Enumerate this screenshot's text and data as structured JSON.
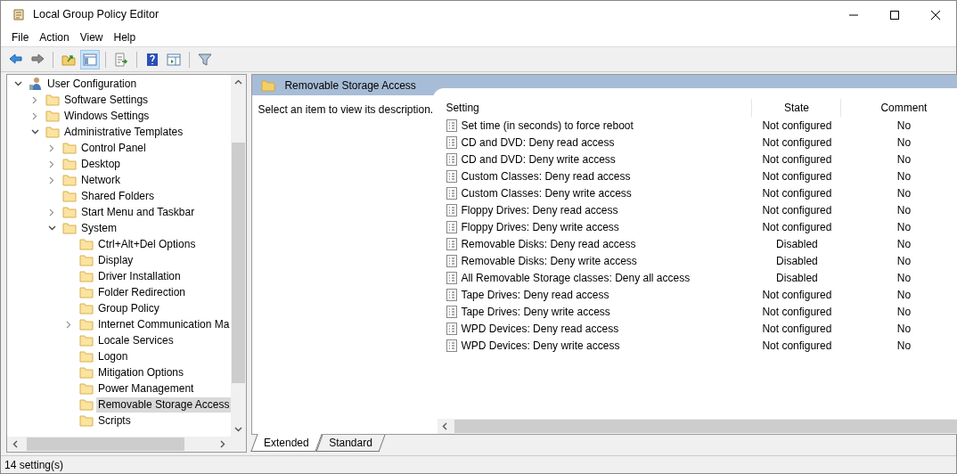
{
  "window": {
    "title": "Local Group Policy Editor"
  },
  "menu": [
    "File",
    "Action",
    "View",
    "Help"
  ],
  "toolbar": [
    {
      "kind": "back",
      "pressed": false
    },
    {
      "kind": "forward",
      "pressed": false
    },
    {
      "kind": "sep"
    },
    {
      "kind": "up",
      "pressed": false
    },
    {
      "kind": "tree",
      "pressed": true
    },
    {
      "kind": "sep"
    },
    {
      "kind": "export",
      "pressed": false
    },
    {
      "kind": "sep"
    },
    {
      "kind": "help",
      "pressed": false
    },
    {
      "kind": "pane",
      "pressed": false
    },
    {
      "kind": "sep"
    },
    {
      "kind": "filter",
      "pressed": false
    }
  ],
  "tree": [
    {
      "label": "User Configuration",
      "kind": "root",
      "expanded": true,
      "selected": false,
      "children": [
        {
          "label": "Software Settings",
          "kind": "branch",
          "expanded": false,
          "selected": false
        },
        {
          "label": "Windows Settings",
          "kind": "branch",
          "expanded": false,
          "selected": false
        },
        {
          "label": "Administrative Templates",
          "kind": "branch",
          "expanded": true,
          "selected": false,
          "children": [
            {
              "label": "Control Panel",
              "kind": "branch",
              "expanded": false,
              "selected": false
            },
            {
              "label": "Desktop",
              "kind": "branch",
              "expanded": false,
              "selected": false
            },
            {
              "label": "Network",
              "kind": "branch",
              "expanded": false,
              "selected": false
            },
            {
              "label": "Shared Folders",
              "kind": "leaf",
              "selected": false
            },
            {
              "label": "Start Menu and Taskbar",
              "kind": "branch",
              "expanded": false,
              "selected": false
            },
            {
              "label": "System",
              "kind": "branch",
              "expanded": true,
              "selected": false,
              "children": [
                {
                  "label": "Ctrl+Alt+Del Options",
                  "kind": "leaf",
                  "selected": false
                },
                {
                  "label": "Display",
                  "kind": "leaf",
                  "selected": false
                },
                {
                  "label": "Driver Installation",
                  "kind": "leaf",
                  "selected": false
                },
                {
                  "label": "Folder Redirection",
                  "kind": "leaf",
                  "selected": false
                },
                {
                  "label": "Group Policy",
                  "kind": "leaf",
                  "selected": false
                },
                {
                  "label": "Internet Communication Ma",
                  "kind": "branch",
                  "expanded": false,
                  "selected": false
                },
                {
                  "label": "Locale Services",
                  "kind": "leaf",
                  "selected": false
                },
                {
                  "label": "Logon",
                  "kind": "leaf",
                  "selected": false
                },
                {
                  "label": "Mitigation Options",
                  "kind": "leaf",
                  "selected": false
                },
                {
                  "label": "Power Management",
                  "kind": "leaf",
                  "selected": false
                },
                {
                  "label": "Removable Storage Access",
                  "kind": "leaf",
                  "selected": true
                },
                {
                  "label": "Scripts",
                  "kind": "leaf",
                  "selected": false
                }
              ]
            }
          ]
        }
      ]
    }
  ],
  "details": {
    "title": "Removable Storage Access",
    "description": "Select an item to view its description.",
    "columns": [
      "Setting",
      "State",
      "Comment"
    ],
    "rows": [
      {
        "setting": "Set time (in seconds) to force reboot",
        "state": "Not configured",
        "comment": "No"
      },
      {
        "setting": "CD and DVD: Deny read access",
        "state": "Not configured",
        "comment": "No"
      },
      {
        "setting": "CD and DVD: Deny write access",
        "state": "Not configured",
        "comment": "No"
      },
      {
        "setting": "Custom Classes: Deny read access",
        "state": "Not configured",
        "comment": "No"
      },
      {
        "setting": "Custom Classes: Deny write access",
        "state": "Not configured",
        "comment": "No"
      },
      {
        "setting": "Floppy Drives: Deny read access",
        "state": "Not configured",
        "comment": "No"
      },
      {
        "setting": "Floppy Drives: Deny write access",
        "state": "Not configured",
        "comment": "No"
      },
      {
        "setting": "Removable Disks: Deny read access",
        "state": "Disabled",
        "comment": "No"
      },
      {
        "setting": "Removable Disks: Deny write access",
        "state": "Disabled",
        "comment": "No"
      },
      {
        "setting": "All Removable Storage classes: Deny all access",
        "state": "Disabled",
        "comment": "No"
      },
      {
        "setting": "Tape Drives: Deny read access",
        "state": "Not configured",
        "comment": "No"
      },
      {
        "setting": "Tape Drives: Deny write access",
        "state": "Not configured",
        "comment": "No"
      },
      {
        "setting": "WPD Devices: Deny read access",
        "state": "Not configured",
        "comment": "No"
      },
      {
        "setting": "WPD Devices: Deny write access",
        "state": "Not configured",
        "comment": "No"
      }
    ]
  },
  "view_tabs": [
    {
      "label": "Extended",
      "selected": true
    },
    {
      "label": "Standard",
      "selected": false
    }
  ],
  "status_bar": "14 setting(s)"
}
